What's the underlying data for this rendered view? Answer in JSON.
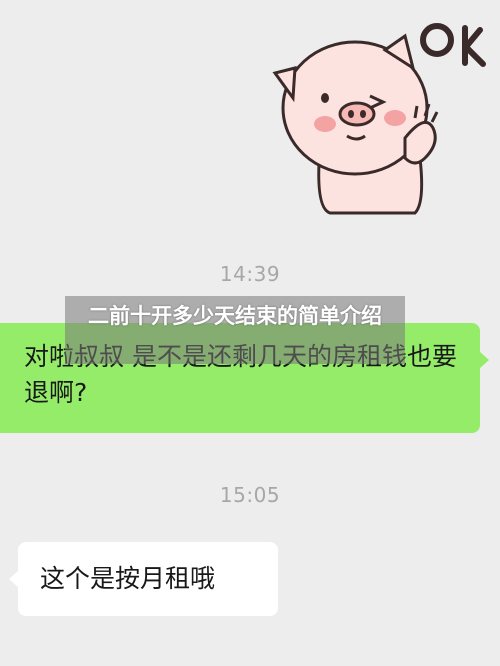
{
  "overlay": {
    "title": "二前十开多少天结束的简单介绍"
  },
  "sticker": {
    "icon": "pig-ok-sticker-icon",
    "text": "ok"
  },
  "messages": [
    {
      "timestamp": "14:39"
    },
    {
      "direction": "outgoing",
      "text": "对啦叔叔 是不是还剩几天的房租钱也要退啊?"
    },
    {
      "timestamp": "15:05"
    },
    {
      "direction": "incoming",
      "text": "这个是按月租哦"
    }
  ],
  "colors": {
    "background": "#ededed",
    "outgoing_bubble": "#95ec69",
    "incoming_bubble": "#ffffff",
    "timestamp_text": "#a7a7a7",
    "pig_pink": "#fbd3d0"
  }
}
